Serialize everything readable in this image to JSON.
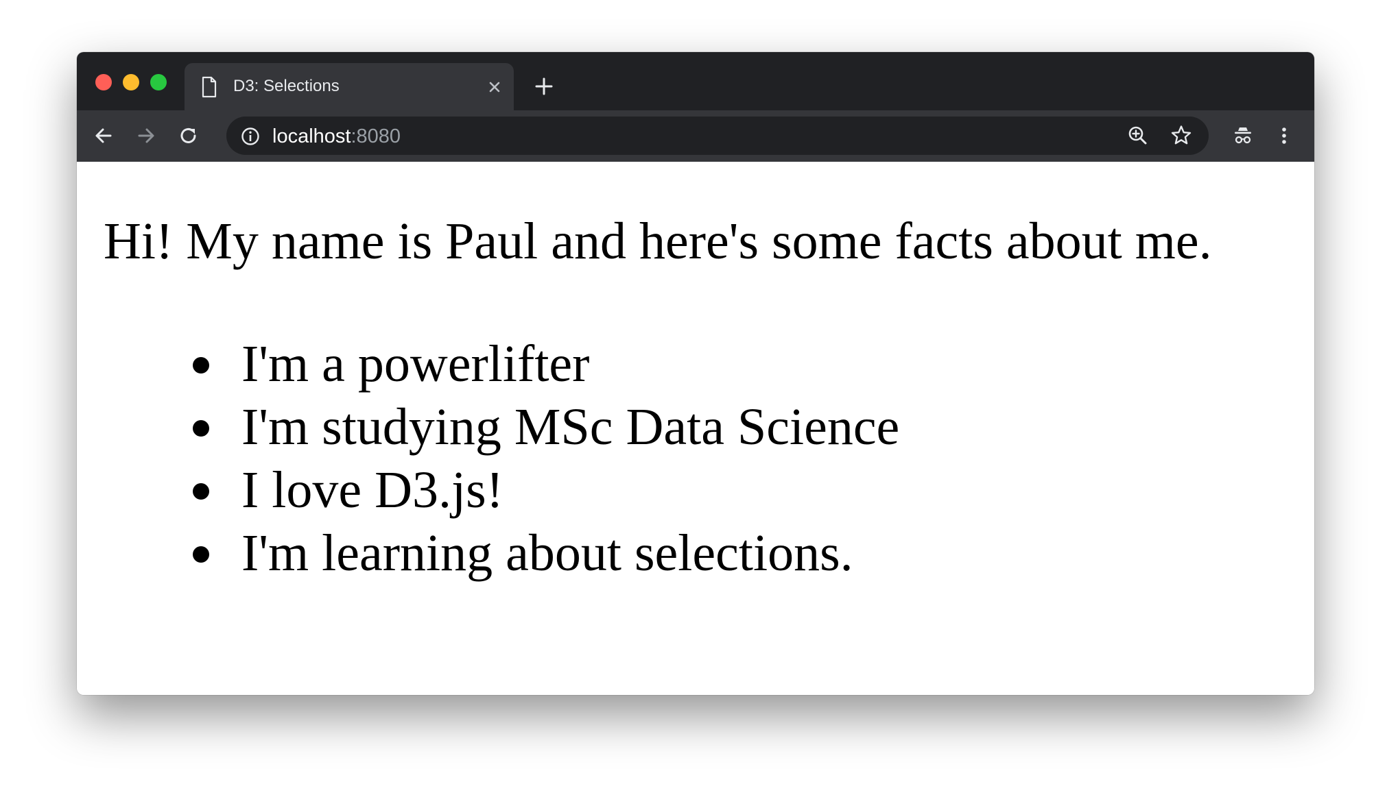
{
  "tab": {
    "title": "D3: Selections"
  },
  "address_bar": {
    "host": "localhost",
    "port": ":8080"
  },
  "page": {
    "heading": "Hi! My name is Paul and here's some facts about me.",
    "facts": [
      "I'm a powerlifter",
      "I'm studying MSc Data Science",
      "I love D3.js!",
      "I'm learning about selections."
    ]
  },
  "icons": {
    "tab": "document-icon",
    "tab_close": "close-icon",
    "new_tab": "plus-icon",
    "back": "arrow-left-icon",
    "forward": "arrow-right-icon",
    "reload": "reload-icon",
    "site_info": "info-icon",
    "zoom": "zoom-in-icon",
    "bookmark": "star-icon",
    "incognito": "incognito-icon",
    "menu": "more-vertical-icon"
  },
  "colors": {
    "tabstrip": "#202124",
    "toolbar": "#35363a",
    "omnibox": "#202124",
    "close": "#ff5f57",
    "minimize": "#febc2e",
    "zoom": "#28c840"
  }
}
